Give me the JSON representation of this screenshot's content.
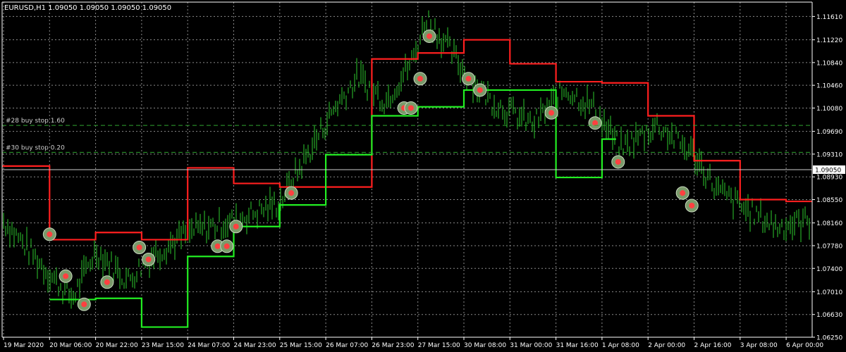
{
  "header": {
    "title": "EURUSD,H1  1.09050 1.09050 1.09050 1.09050"
  },
  "chart_data": {
    "type": "line",
    "symbol": "EURUSD",
    "timeframe": "H1",
    "grid": true,
    "ylim": [
      1.0625,
      1.1185
    ],
    "y_ticks": [
      "1.11610",
      "1.11220",
      "1.10840",
      "1.10460",
      "1.10080",
      "1.09690",
      "1.09310",
      "1.08930",
      "1.08550",
      "1.08160",
      "1.07780",
      "1.07400",
      "1.07010",
      "1.06630",
      "1.06250"
    ],
    "x_ticks": [
      "19 Mar 2020",
      "20 Mar 06:00",
      "20 Mar 22:00",
      "23 Mar 15:00",
      "24 Mar 07:00",
      "24 Mar 23:00",
      "25 Mar 15:00",
      "26 Mar 07:00",
      "26 Mar 23:00",
      "27 Mar 15:00",
      "30 Mar 08:00",
      "31 Mar 00:00",
      "31 Mar 16:00",
      "1 Apr 08:00",
      "2 Apr 00:00",
      "2 Apr 16:00",
      "3 Apr 08:00",
      "6 Apr 00:00"
    ],
    "current_price": {
      "label": "1.09050",
      "value": 1.0905
    },
    "annotations": [
      {
        "text": "#28 buy stop 1.60",
        "value": 1.0979,
        "color": "#2fa52f"
      },
      {
        "text": "#30 buy stop 0.20",
        "value": 1.0934,
        "color": "#2fa52f"
      }
    ],
    "colors": {
      "candles": "#2ecc2e",
      "upper_stop": "#ff1f1f",
      "lower_stop": "#22ee22",
      "grid": "#8a8a8a",
      "text": "#ffffff"
    },
    "series": [
      {
        "type": "step",
        "color": "#ff1f1f",
        "x": [
          "19 Mar 2020",
          "20 Mar 06:00",
          "20 Mar 22:00",
          "23 Mar 15:00",
          "24 Mar 07:00",
          "24 Mar 23:00",
          "25 Mar 15:00",
          "26 Mar 23:00",
          "27 Mar 15:00",
          "30 Mar 08:00",
          "31 Mar 00:00",
          "31 Mar 16:00",
          "1 Apr 08:00",
          "2 Apr 00:00",
          "2 Apr 16:00",
          "3 Apr 08:00",
          "6 Apr 00:00"
        ],
        "values": [
          1.0911,
          1.0788,
          1.08,
          1.0788,
          1.0908,
          1.0882,
          1.0876,
          1.109,
          1.11,
          1.1122,
          1.1082,
          1.1052,
          1.105,
          1.0995,
          1.092,
          1.0855,
          1.0852
        ]
      },
      {
        "type": "step",
        "color": "#22ee22",
        "x": [
          "20 Mar 06:00",
          "20 Mar 22:00",
          "23 Mar 15:00",
          "24 Mar 07:00",
          "24 Mar 23:00",
          "25 Mar 15:00",
          "26 Mar 07:00",
          "26 Mar 23:00",
          "27 Mar 15:00",
          "30 Mar 08:00",
          "31 Mar 00:00",
          "31 Mar 16:00",
          "1 Apr 08:00"
        ],
        "values": [
          1.0688,
          1.069,
          1.0642,
          1.076,
          1.081,
          1.0846,
          1.093,
          1.0995,
          1.101,
          1.1038,
          1.1038,
          1.0892,
          1.0956
        ]
      }
    ]
  }
}
